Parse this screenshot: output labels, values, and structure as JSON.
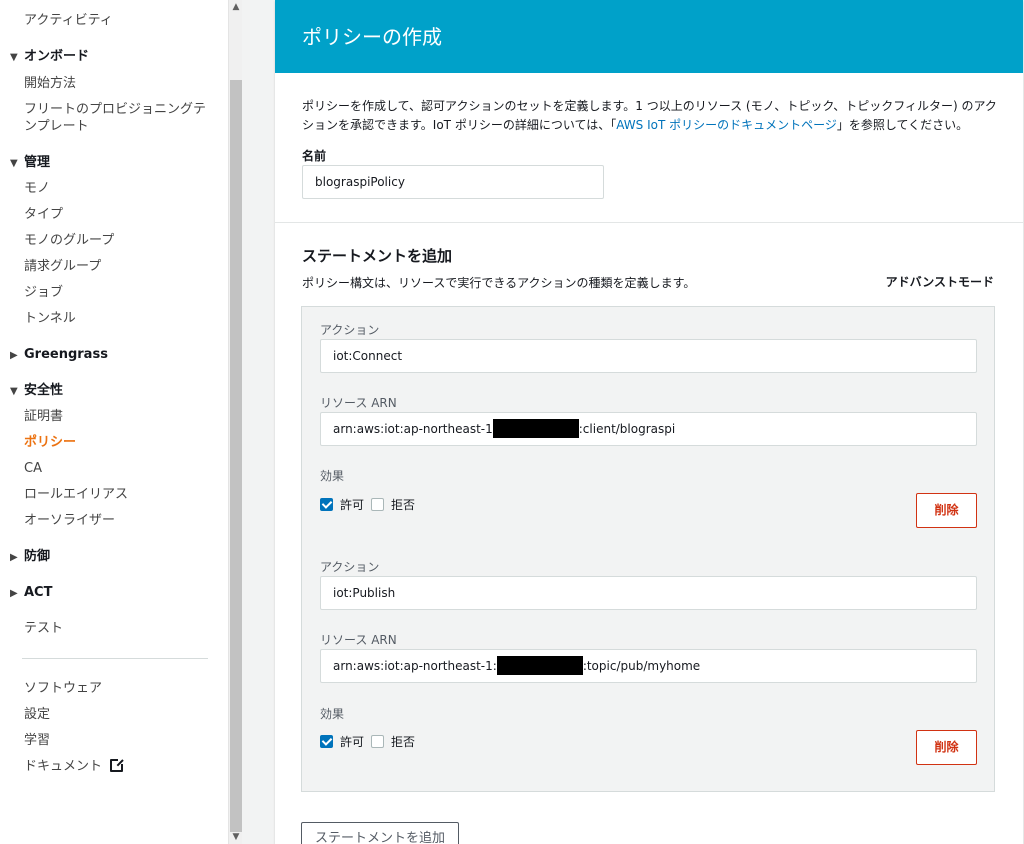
{
  "sidebar": {
    "items": [
      {
        "id": "activity",
        "label": "アクティビティ"
      },
      {
        "id": "onboard",
        "label": "オンボード",
        "section": true,
        "expanded": true
      },
      {
        "id": "getting-started",
        "label": "開始方法"
      },
      {
        "id": "fleet-provisioning",
        "label": "フリートのプロビジョニングテンプレート"
      },
      {
        "id": "manage",
        "label": "管理",
        "section": true,
        "expanded": true
      },
      {
        "id": "things",
        "label": "モノ"
      },
      {
        "id": "types",
        "label": "タイプ"
      },
      {
        "id": "thing-groups",
        "label": "モノのグループ"
      },
      {
        "id": "billing-groups",
        "label": "請求グループ"
      },
      {
        "id": "jobs",
        "label": "ジョブ"
      },
      {
        "id": "tunnels",
        "label": "トンネル"
      },
      {
        "id": "greengrass",
        "label": "Greengrass",
        "section": true,
        "expanded": false
      },
      {
        "id": "security",
        "label": "安全性",
        "section": true,
        "expanded": true
      },
      {
        "id": "certificates",
        "label": "証明書"
      },
      {
        "id": "policies",
        "label": "ポリシー",
        "active": true
      },
      {
        "id": "ca",
        "label": "CA"
      },
      {
        "id": "role-aliases",
        "label": "ロールエイリアス"
      },
      {
        "id": "authorizers",
        "label": "オーソライザー"
      },
      {
        "id": "defend",
        "label": "防御",
        "section": true,
        "expanded": false
      },
      {
        "id": "act",
        "label": "ACT",
        "section": true,
        "expanded": false
      },
      {
        "id": "test",
        "label": "テスト"
      },
      {
        "id": "software",
        "label": "ソフトウェア"
      },
      {
        "id": "settings",
        "label": "設定"
      },
      {
        "id": "learn",
        "label": "学習"
      },
      {
        "id": "documents",
        "label": "ドキュメント"
      }
    ],
    "caret_expanded": "▼",
    "caret_collapsed": "▶"
  },
  "scrollbar": {
    "up": "▲",
    "down": "▼"
  },
  "page": {
    "title": "ポリシーの作成",
    "description_before": "ポリシーを作成して、認可アクションのセットを定義します。1 つ以上のリソース (モノ、トピック、トピックフィルター) のアクションを承認できます。IoT ポリシーの詳細については、「",
    "description_link": "AWS IoT ポリシーのドキュメントページ",
    "description_after": "」を参照してください。",
    "name_label": "名前",
    "name_value": "blograspiPolicy"
  },
  "statements": {
    "title": "ステートメントを追加",
    "subtitle": "ポリシー構文は、リソースで実行できるアクションの種類を定義します。",
    "advanced_mode": "アドバンストモード",
    "action_label": "アクション",
    "resource_label": "リソース ARN",
    "effect_label": "効果",
    "allow_label": "許可",
    "deny_label": "拒否",
    "delete_label": "削除",
    "items": [
      {
        "action": "iot:Connect",
        "resource_prefix": "arn:aws:iot:ap-northeast-1",
        "resource_suffix": ":client/blograspi",
        "allow": true,
        "deny": false
      },
      {
        "action": "iot:Publish",
        "resource_prefix": "arn:aws:iot:ap-northeast-1:",
        "resource_suffix": ":topic/pub/myhome",
        "allow": true,
        "deny": false
      }
    ],
    "add_button": "ステートメントを追加"
  },
  "colors": {
    "header": "#00a1c9",
    "active_nav": "#ec7211",
    "link": "#0073bb",
    "danger": "#d13212"
  }
}
